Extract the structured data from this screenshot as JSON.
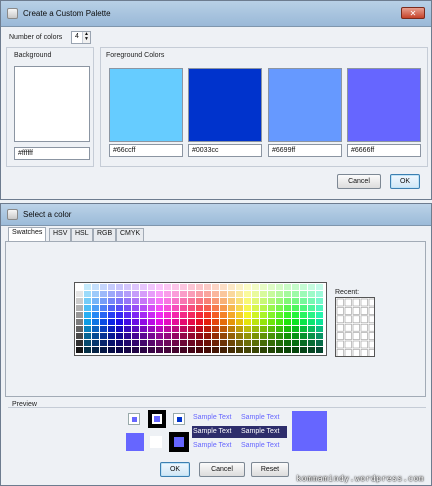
{
  "palette_dialog": {
    "title": "Create a Custom Palette",
    "number_of_colors_label": "Number of colors",
    "number_of_colors_value": "4",
    "background": {
      "title": "Background",
      "color": "#ffffff",
      "hex": "#ffffff"
    },
    "foreground": {
      "title": "Foreground Colors",
      "colors": [
        {
          "color": "#66ccff",
          "hex": "#66ccff"
        },
        {
          "color": "#0033cc",
          "hex": "#0033cc"
        },
        {
          "color": "#6699ff",
          "hex": "#6699ff"
        },
        {
          "color": "#6666ff",
          "hex": "#6666ff"
        }
      ]
    },
    "cancel_label": "Cancel",
    "ok_label": "OK"
  },
  "color_dialog": {
    "title": "Select a color",
    "tabs": [
      "Swatches",
      "HSV",
      "HSL",
      "RGB",
      "CMYK"
    ],
    "active_tab": "Swatches",
    "recent_label": "Recent:",
    "preview_label": "Preview",
    "sample_text": "Sample Text",
    "preview_color": "#6666ff",
    "ok_label": "OK",
    "cancel_label": "Cancel",
    "reset_label": "Reset"
  },
  "watermark": "kommamindy.wordpress.com"
}
